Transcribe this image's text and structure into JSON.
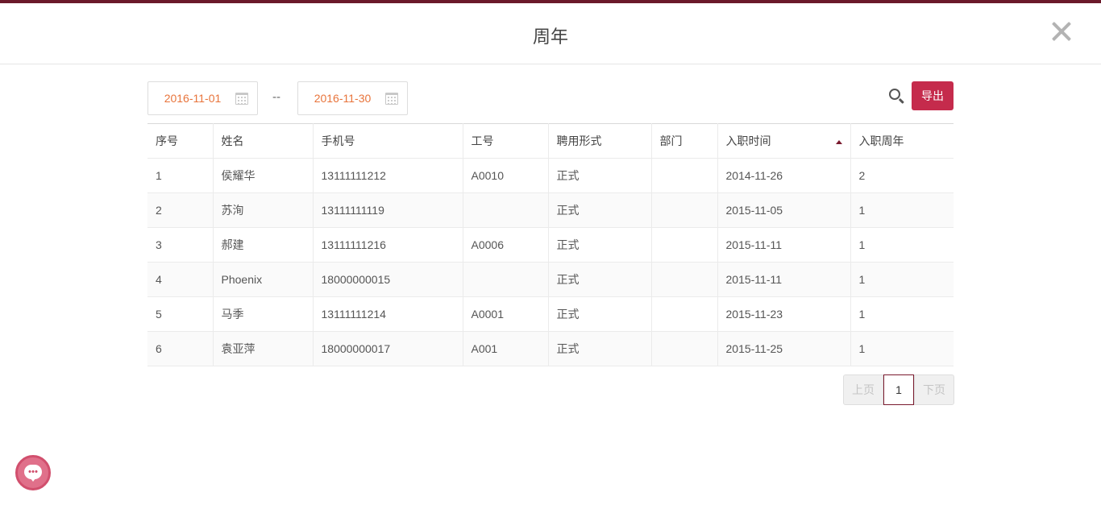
{
  "header": {
    "title": "周年"
  },
  "filters": {
    "start_date": "2016-11-01",
    "end_date": "2016-11-30",
    "separator": "--",
    "export_label": "导出"
  },
  "table": {
    "columns": [
      "序号",
      "姓名",
      "手机号",
      "工号",
      "聘用形式",
      "部门",
      "入职时间",
      "入职周年"
    ],
    "sorted_column": "入职时间",
    "sort_direction": "ascending",
    "rows": [
      [
        "1",
        "侯耀华",
        "13111111212",
        "A0010",
        "正式",
        "",
        "2014-11-26",
        "2"
      ],
      [
        "2",
        "苏洵",
        "13111111119",
        "",
        "正式",
        "",
        "2015-11-05",
        "1"
      ],
      [
        "3",
        "郝建",
        "13111111216",
        "A0006",
        "正式",
        "",
        "2015-11-11",
        "1"
      ],
      [
        "4",
        "Phoenix",
        "18000000015",
        "",
        "正式",
        "",
        "2015-11-11",
        "1"
      ],
      [
        "5",
        "马季",
        "13111111214",
        "A0001",
        "正式",
        "",
        "2015-11-23",
        "1"
      ],
      [
        "6",
        "袁亚萍",
        "18000000017",
        "A001",
        "正式",
        "",
        "2015-11-25",
        "1"
      ]
    ]
  },
  "pagination": {
    "prev_label": "上页",
    "current_page": "1",
    "next_label": "下页"
  },
  "icons": {
    "close": "close-icon",
    "calendar": "calendar-icon",
    "search": "search-icon",
    "sort": "sort-ascending-icon",
    "chat": "chat-support-icon"
  },
  "colors": {
    "top_bar": "#6b1a2a",
    "date_text": "#e8743b",
    "export_button": "#c52b4c",
    "pager_active_border": "#7a1a2e",
    "chat_button": "#e0708a"
  }
}
